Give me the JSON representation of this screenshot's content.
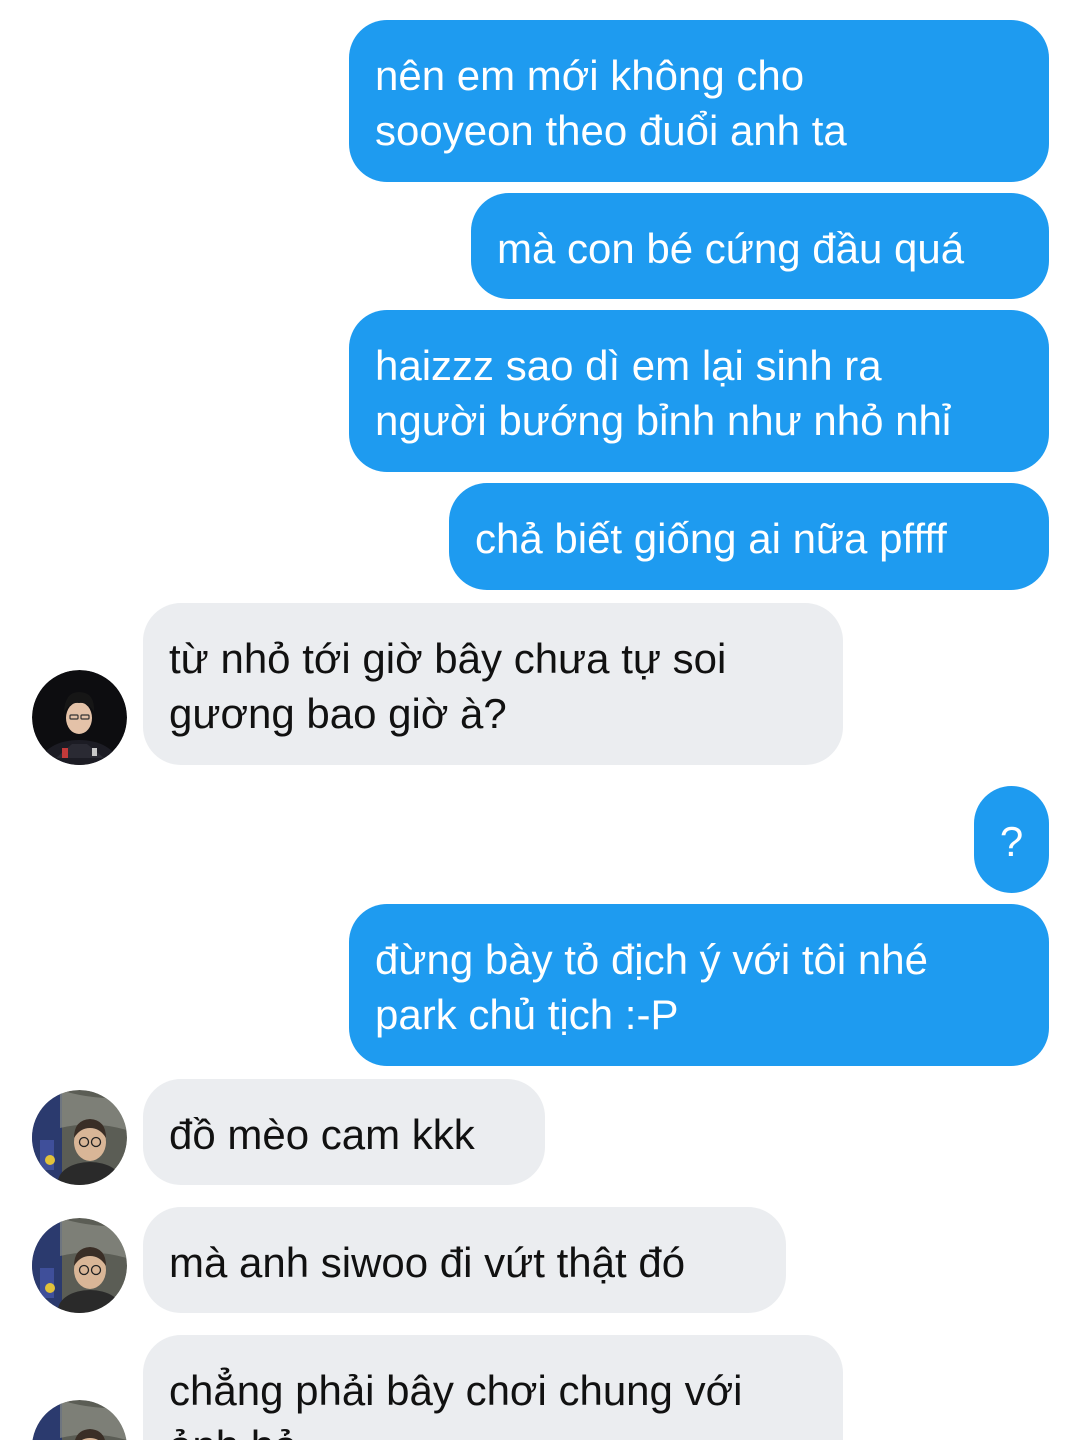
{
  "messages": [
    {
      "side": "sent",
      "text": "nên em mới không cho\nsooyeon theo đuổi anh ta"
    },
    {
      "side": "sent",
      "text": "mà con bé cứng đầu quá"
    },
    {
      "side": "sent",
      "text": "haizzz sao dì em lại sinh ra\nngười bướng bỉnh như nhỏ nhỉ"
    },
    {
      "side": "sent",
      "text": "chả biết giống ai nữa pffff"
    },
    {
      "side": "received",
      "text": "từ nhỏ tới giờ bây chưa tự soi\ngương bao giờ à?"
    },
    {
      "side": "sent",
      "text": "?"
    },
    {
      "side": "sent",
      "text": "đừng bày tỏ địch ý với tôi nhé\npark chủ tịch :-P"
    },
    {
      "side": "received",
      "text": "đồ mèo cam kkk"
    },
    {
      "side": "received",
      "text": "mà anh siwoo đi vứt thật đó"
    },
    {
      "side": "received",
      "text": "chẳng phải bây chơi chung với\nảnh hả"
    }
  ],
  "colors": {
    "sent_bubble": "#1e9bf0",
    "received_bubble": "#ebedf0",
    "sent_text": "#ffffff",
    "received_text": "#111111"
  },
  "icons": {
    "avatar_1": "contact-avatar-dark-jersey",
    "avatar_2": "contact-avatar-glasses"
  }
}
